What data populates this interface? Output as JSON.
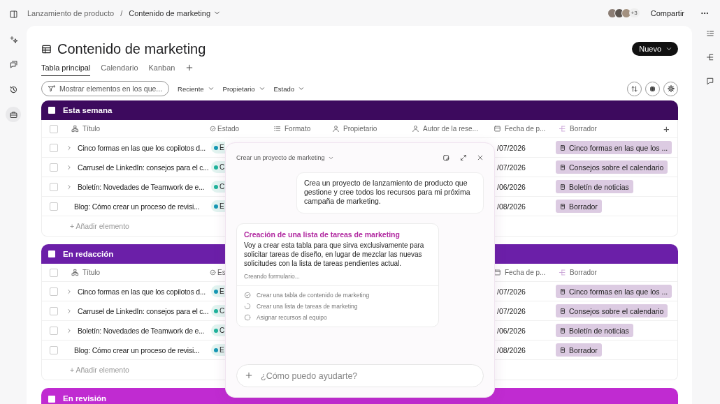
{
  "breadcrumb": {
    "parent": "Lanzamiento de producto",
    "separator": "/",
    "current": "Contenido de marketing"
  },
  "collaborators": {
    "more_count": "+3",
    "share_button": "Compartir"
  },
  "page": {
    "title": "Contenido de marketing",
    "new_button": "Nuevo"
  },
  "tabs": [
    {
      "label": "Tabla principal",
      "selected": true
    },
    {
      "label": "Calendario",
      "selected": false
    },
    {
      "label": "Kanban",
      "selected": false
    }
  ],
  "filters": {
    "search": "Mostrar elementos en los que...",
    "dropdowns": [
      "Reciente",
      "Propietario",
      "Estado"
    ]
  },
  "groups": [
    {
      "name": "Esta semana",
      "color": "#3d0a5e",
      "all_checked": false,
      "add_column_button": "+",
      "add_row": "+ Añadir elemento",
      "columns": [
        {
          "kind": "title",
          "label": "Título"
        },
        {
          "kind": "status",
          "label": "Estado"
        },
        {
          "kind": "format",
          "label": "Formato"
        },
        {
          "kind": "owner",
          "label": "Propietario"
        },
        {
          "kind": "reviewer",
          "label": "Autor de la rese..."
        },
        {
          "kind": "date",
          "label": "Fecha de p..."
        },
        {
          "kind": "draft",
          "label": "Borrador"
        }
      ],
      "rows": [
        {
          "checked": false,
          "expandable": true,
          "title": "Cinco formas en las que los copilotos d...",
          "status": "E",
          "color": "#1598b4",
          "date": "/07/2026",
          "draft": "Cinco formas en las que los ..."
        },
        {
          "checked": false,
          "expandable": true,
          "title": "Carrusel de LinkedIn: consejos para el c...",
          "status": "C",
          "color": "#1fb39c",
          "date": "/07/2026",
          "draft": "Consejos sobre el calendario"
        },
        {
          "checked": false,
          "expandable": true,
          "title": "Boletín: Novedades de Teamwork de e...",
          "status": "C",
          "color": "#1fb39c",
          "date": "/06/2026",
          "draft": "Boletín de noticias"
        },
        {
          "checked": false,
          "expandable": false,
          "title": "Blog: Cómo crear un proceso de revisi...",
          "status": "E",
          "color": "#1598b4",
          "date": "/08/2026",
          "draft": "Borrador"
        }
      ]
    },
    {
      "name": "En redacción",
      "color": "#6b1fa8",
      "all_checked": false,
      "add_row": "+ Añadir elemento",
      "columns": [
        {
          "kind": "title",
          "label": "Título"
        },
        {
          "kind": "status",
          "label": "Es"
        },
        {
          "kind": "date",
          "label": "Fecha de p..."
        },
        {
          "kind": "draft",
          "label": "Borrador"
        }
      ],
      "rows": [
        {
          "checked": false,
          "expandable": true,
          "title": "Cinco formas en las que los copilotos d...",
          "status": "E",
          "color": "#1598b4",
          "date": "/07/2026",
          "draft": "Cinco formas en las que los ..."
        },
        {
          "checked": false,
          "expandable": true,
          "title": "Carrusel de LinkedIn: consejos para el c...",
          "status": "C",
          "color": "#1fb39c",
          "date": "/07/2026",
          "draft": "Consejos sobre el calendario"
        },
        {
          "checked": false,
          "expandable": true,
          "title": "Boletín: Novedades de Teamwork de e...",
          "status": "C",
          "color": "#1fb39c",
          "date": "/06/2026",
          "draft": "Boletín de noticias"
        },
        {
          "checked": false,
          "expandable": false,
          "title": "Blog: Cómo crear un proceso de revisi...",
          "status": "E",
          "color": "#1598b4",
          "date": "/08/2026",
          "draft": "Borrador"
        }
      ]
    },
    {
      "name": "En revisión",
      "color": "#c02bd1"
    }
  ],
  "chat": {
    "title": "Crear un proyecto de marketing",
    "user_message": "Crea un proyecto de lanzamiento de producto que gestione y cree todos los recursos para mi próxima campaña de marketing.",
    "reply": {
      "title": "Creación de una lista de tareas de marketing",
      "text": "Voy a crear esta tabla para que sirva exclusivamente para solicitar tareas de diseño, en lugar de mezclar las nuevas solicitudes con la lista de tareas pendientes actual.",
      "progress": "Creando formulario...",
      "steps": [
        {
          "label": "Crear una tabla de contenido de marketing",
          "kind": "done"
        },
        {
          "label": "Crear una lista de tareas de marketing",
          "kind": "running"
        },
        {
          "label": "Asignar recursos al equipo",
          "kind": "pending"
        }
      ]
    },
    "input_placeholder": "¿Cómo puedo ayudarte?"
  }
}
